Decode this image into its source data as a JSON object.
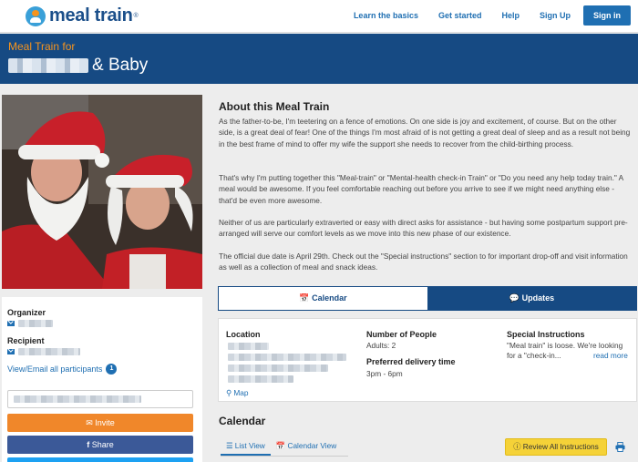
{
  "nav": {
    "logo_text": "meal train",
    "logo_tm": "®",
    "links": [
      "Learn the basics",
      "Get started",
      "Help",
      "Sign Up"
    ],
    "signin": "Sign in"
  },
  "header": {
    "subtitle": "Meal Train for",
    "title_suffix": "& Baby"
  },
  "sidebar": {
    "organizer_label": "Organizer",
    "recipient_label": "Recipient",
    "participants_link": "View/Email all participants",
    "participants_count": "1",
    "invite_label": "Invite",
    "share_label": "Share"
  },
  "about": {
    "title": "About this Meal Train",
    "paragraphs": [
      "As the father-to-be, I'm teetering on a fence of emotions. On one side is joy and excitement, of course. But on the other side, is a great deal of fear! One of the things I'm most afraid of is not getting a great deal of sleep and as a result not being in the best frame of mind to offer my wife the support she needs to recover from the child-birthing process.",
      "That's why I'm putting together this \"Meal-train\" or \"Mental-health check-in Train\" or \"Do you need any help today train.\" A meal would be awesome. If you feel comfortable reaching out before you arrive to see if we might need anything else - that'd be even more awesome.",
      "Neither of us are particularly extraverted or easy with direct asks for assistance - but having some postpartum support pre-arranged will serve our comfort levels as we move into this new phase of our existence.",
      "The official due date is April 29th. Check out the \"Special instructions\" section to for important drop-off and visit information as well as a collection of meal and snack ideas."
    ]
  },
  "tabs": {
    "calendar": "Calendar",
    "updates": "Updates"
  },
  "info": {
    "location_label": "Location",
    "map_link": "Map",
    "people_label": "Number of People",
    "people_value": "Adults: 2",
    "delivery_label": "Preferred delivery time",
    "delivery_value": "3pm - 6pm",
    "instructions_label": "Special Instructions",
    "instructions_text_1": "\"Meal train\" is loose. We're looking",
    "instructions_text_2": "for a \"check-in...",
    "read_more": "read more"
  },
  "calendar_section": {
    "title": "Calendar",
    "list_view": "List View",
    "calendar_view": "Calendar View",
    "review_button": "Review All Instructions"
  },
  "colors": {
    "brand_blue": "#164a83",
    "link_blue": "#1f6fb2",
    "orange": "#f0872a",
    "facebook": "#3b5998",
    "yellow": "#f5d238"
  }
}
